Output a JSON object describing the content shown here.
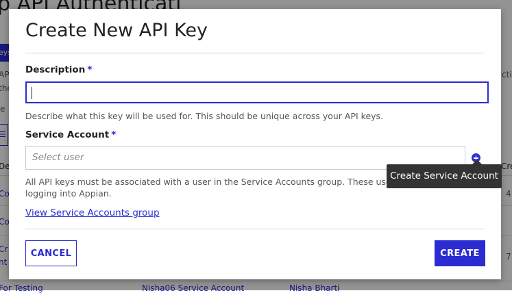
{
  "background": {
    "page_title": "p API Authenticati",
    "tab_fragment": "eys",
    "side_text_1": "API",
    "side_text_2": "the",
    "side_text_3": "e",
    "right_text": "ctiv",
    "col_fragment_left": "De",
    "col_fragment_right": "Cre",
    "rows": [
      {
        "left": "Co",
        "right": "4."
      },
      {
        "left": "Co",
        "right": ""
      },
      {
        "left": "Cr",
        "right": "7."
      },
      {
        "left": "nt",
        "right": ""
      }
    ],
    "bottom_row": {
      "name": "For Testing",
      "account": "Nisha06 Service Account",
      "user": "Nisha Bharti"
    }
  },
  "modal": {
    "title": "Create New API Key",
    "description": {
      "label": "Description",
      "required_mark": "*",
      "value": "",
      "help": "Describe what this key will be used for. This should be unique across your API keys."
    },
    "service_account": {
      "label": "Service Account",
      "required_mark": "*",
      "placeholder": "Select user",
      "help_line1": "All API keys must be associated with a user in the Service Accounts group. These users a",
      "help_line2": "logging into Appian.",
      "add_icon": "plus-circle-icon"
    },
    "link": "View Service Accounts group",
    "buttons": {
      "cancel": "CANCEL",
      "create": "CREATE"
    }
  },
  "tooltip": {
    "text": "Create Service Account"
  },
  "colors": {
    "accent": "#2a2cd1",
    "overlay": "rgba(0,0,0,0.42)",
    "tooltip_bg": "#333333"
  }
}
